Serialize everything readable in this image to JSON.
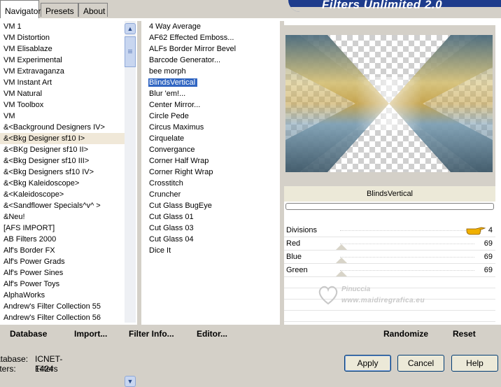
{
  "tabs": [
    "Navigator",
    "Presets",
    "About"
  ],
  "app_title": "Filters Unlimited 2.0",
  "categories": [
    "VM 1",
    "VM Distortion",
    "VM Elisablaze",
    "VM Experimental",
    "VM Extravaganza",
    "VM Instant Art",
    "VM Natural",
    "VM Toolbox",
    "VM",
    "&<Background Designers IV>",
    "&<Bkg Designer sf10 I>",
    "&<BKg Designer sf10 II>",
    "&<Bkg Designer sf10 III>",
    "&<Bkg Designers sf10 IV>",
    "&<Bkg Kaleidoscope>",
    "&<Kaleidoscope>",
    "&<Sandflower Specials^v^ >",
    "&Neu!",
    "[AFS IMPORT]",
    "AB Filters 2000",
    "Alf's Border FX",
    "Alf's Power Grads",
    "Alf's Power Sines",
    "Alf's Power Toys",
    "AlphaWorks",
    "Andrew's Filter Collection 55",
    "Andrew's Filter Collection 56"
  ],
  "selected_category": "&<Bkg Designer sf10 I>",
  "filters": [
    "4 Way Average",
    "AF62 Effected Emboss...",
    "ALFs Border Mirror Bevel",
    "Barcode Generator...",
    "bee morph",
    "BlindsVertical",
    "Blur 'em!...",
    "Center Mirror...",
    "Circle Pede",
    "Circus Maximus",
    "Cirquelate",
    "Convergance",
    "Corner Half Wrap",
    "Corner Right Wrap",
    "Crosstitch",
    "Cruncher",
    "Cut Glass  BugEye",
    "Cut Glass 01",
    "Cut Glass 03",
    "Cut Glass 04",
    "Dice It"
  ],
  "selected_filter": "BlindsVertical",
  "preview_label": "BlindsVertical",
  "params": [
    {
      "label": "Divisions",
      "value": "4"
    },
    {
      "label": "Red",
      "value": "69"
    },
    {
      "label": "Blue",
      "value": "69"
    },
    {
      "label": "Green",
      "value": "69"
    }
  ],
  "watermark": {
    "line1": "Pinuccia",
    "line2": "www.maidiregrafica.eu"
  },
  "bottom_buttons": {
    "database": "Database",
    "import": "Import...",
    "filter_info": "Filter Info...",
    "editor": "Editor...",
    "randomize": "Randomize",
    "reset": "Reset"
  },
  "status": {
    "database_key": "atabase:",
    "database_val": "ICNET-Filters",
    "filters_key": "ilters:",
    "filters_val": "1424"
  },
  "dialog_buttons": {
    "apply": "Apply",
    "cancel": "Cancel",
    "help": "Help"
  },
  "colors": {
    "selection": "#3166c2",
    "banner": "#1e3c8c",
    "window": "#d4d0c8"
  }
}
